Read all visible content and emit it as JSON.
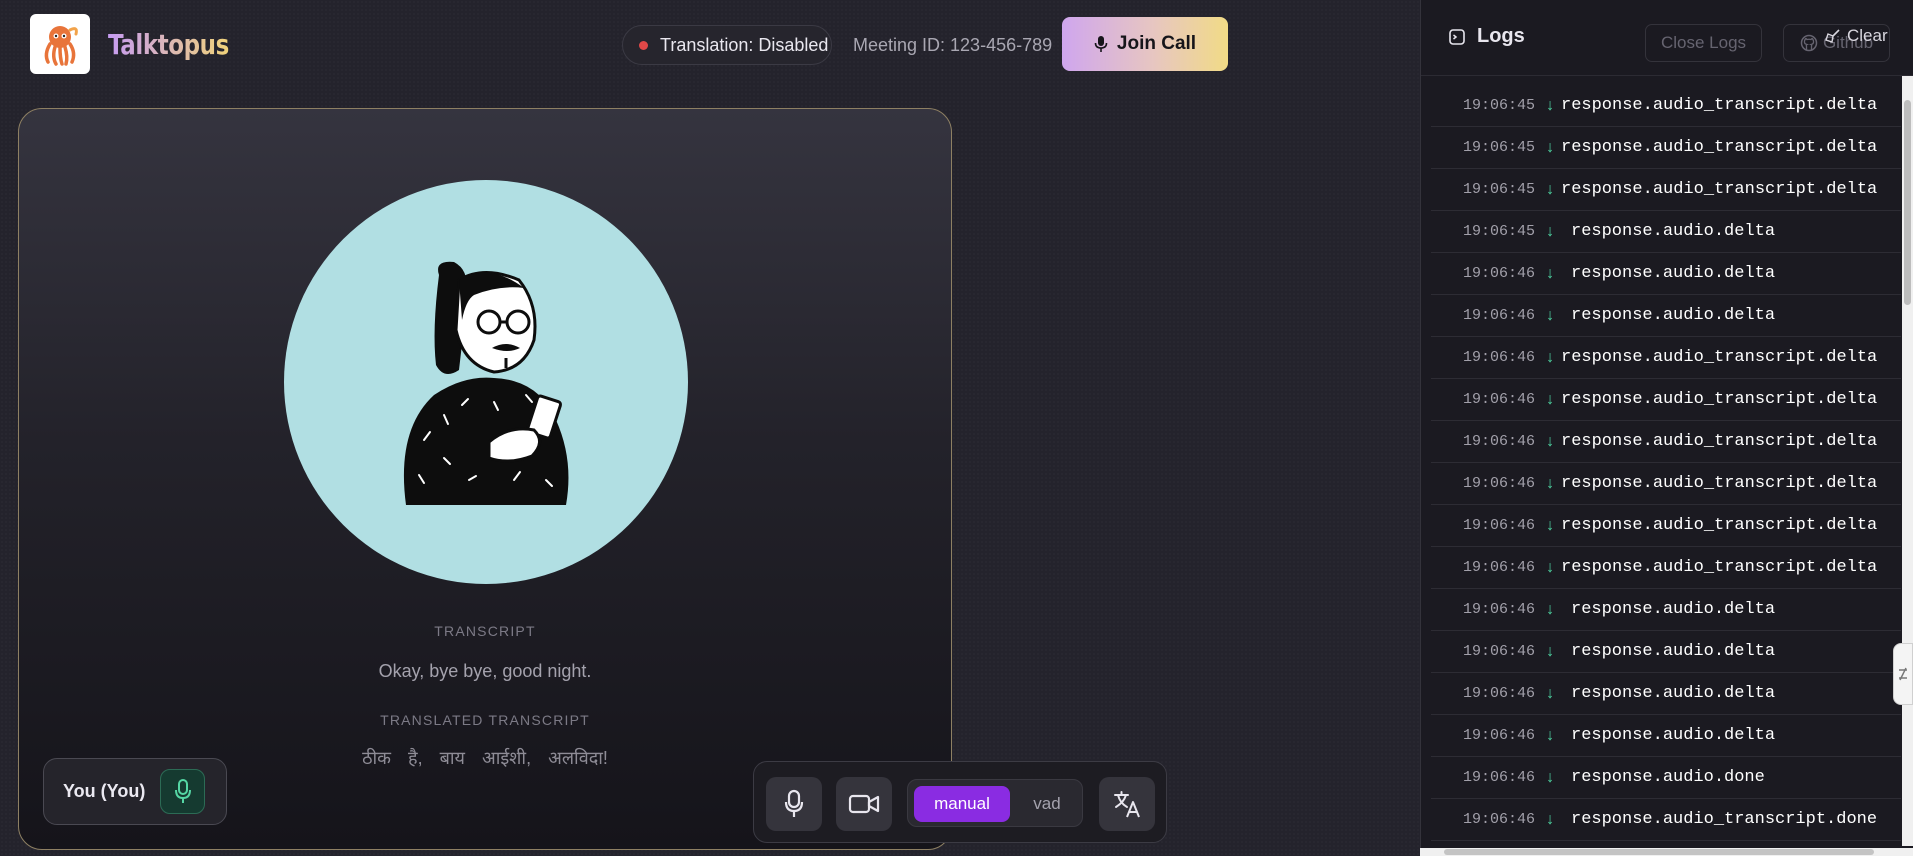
{
  "app": {
    "name": "Talktopus"
  },
  "header": {
    "translation_status": "Translation: Disabled",
    "meeting_id": "Meeting ID: 123-456-789",
    "join_label": "Join Call"
  },
  "video": {
    "transcript_heading": "TRANSCRIPT",
    "transcript_text": "Okay, bye bye, good night.",
    "translated_heading": "TRANSLATED TRANSCRIPT",
    "translated_text": "ठीक है, बाय आईशी, अलविदा!",
    "participant_label": "You (You)"
  },
  "controls": {
    "mode_manual": "manual",
    "mode_vad": "vad",
    "active_mode": "manual"
  },
  "logs": {
    "title": "Logs",
    "close_label": "Close Logs",
    "github_label": "Github",
    "clear_label": "Clear",
    "entries": [
      {
        "time": "19:06:45",
        "event": "response.audio_transcript.delta"
      },
      {
        "time": "19:06:45",
        "event": "response.audio_transcript.delta"
      },
      {
        "time": "19:06:45",
        "event": "response.audio_transcript.delta"
      },
      {
        "time": "19:06:45",
        "event": "response.audio.delta"
      },
      {
        "time": "19:06:46",
        "event": "response.audio.delta"
      },
      {
        "time": "19:06:46",
        "event": "response.audio.delta"
      },
      {
        "time": "19:06:46",
        "event": "response.audio_transcript.delta"
      },
      {
        "time": "19:06:46",
        "event": "response.audio_transcript.delta"
      },
      {
        "time": "19:06:46",
        "event": "response.audio_transcript.delta"
      },
      {
        "time": "19:06:46",
        "event": "response.audio_transcript.delta"
      },
      {
        "time": "19:06:46",
        "event": "response.audio_transcript.delta"
      },
      {
        "time": "19:06:46",
        "event": "response.audio_transcript.delta"
      },
      {
        "time": "19:06:46",
        "event": "response.audio.delta"
      },
      {
        "time": "19:06:46",
        "event": "response.audio.delta"
      },
      {
        "time": "19:06:46",
        "event": "response.audio.delta"
      },
      {
        "time": "19:06:46",
        "event": "response.audio.delta"
      },
      {
        "time": "19:06:46",
        "event": "response.audio.done"
      },
      {
        "time": "19:06:46",
        "event": "response.audio_transcript.done"
      }
    ]
  },
  "colors": {
    "accent_purple": "#8a2ce2",
    "status_red": "#e04848",
    "arrow_green": "#4ed3a0",
    "avatar_bg": "#b1dfe3"
  },
  "icons": {
    "logo": "octopus-icon",
    "join": "mic-icon",
    "participant_mic": "mic-icon",
    "controls": [
      "mic-icon",
      "video-camera-icon",
      "translate-icon"
    ],
    "logs_title": "terminal-icon",
    "github": "github-icon",
    "clear": "broom-icon",
    "log_direction": "arrow-down-icon"
  }
}
